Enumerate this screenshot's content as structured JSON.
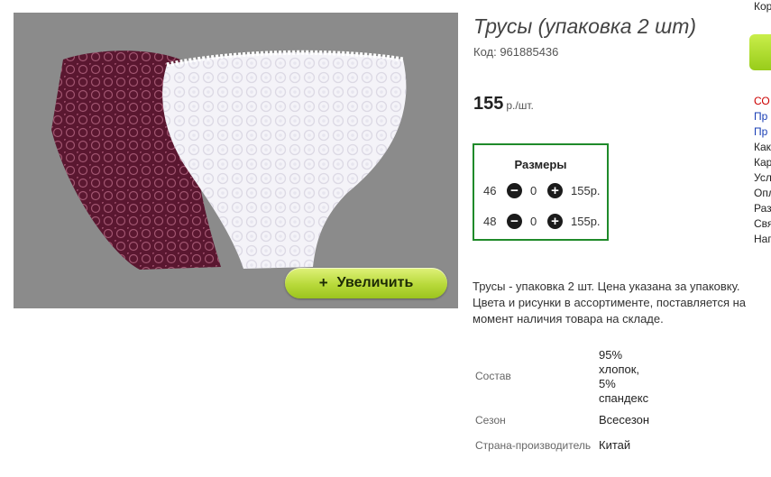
{
  "product": {
    "title": "Трусы (упаковка 2 шт)",
    "code": "Код: 961885436",
    "price": "155",
    "price_unit": "р./шт."
  },
  "image": {
    "zoom_plus": "+",
    "zoom_label": "Увеличить"
  },
  "sizes": {
    "header": "Размеры",
    "rows": [
      {
        "size": "46",
        "minus": "−",
        "qty": "0",
        "plus": "+",
        "price": "155р."
      },
      {
        "size": "48",
        "minus": "−",
        "qty": "0",
        "plus": "+",
        "price": "155р."
      }
    ]
  },
  "description": "Трусы - упаковка 2 шт. Цена указана за упаковку. Цвета и рисунки в ассортименте, поставляется на момент наличия товара на складе.",
  "specs": [
    {
      "label": "Состав",
      "value": "95%\nхлопок,\n5%\nспандекс"
    },
    {
      "label": "Сезон",
      "value": "Всесезон"
    },
    {
      "label": "Страна-производитель",
      "value": "Китай"
    }
  ],
  "sidebar": {
    "top": "Кор",
    "items": [
      "СО",
      "Пр",
      "Пр",
      "Как",
      "Кар",
      "Усл",
      "Опл",
      "Раз",
      "Свя",
      "Нап"
    ],
    "item_colors": [
      "#cc0000",
      "#1a3fb5",
      "#1a3fb5",
      "#222222",
      "#222222",
      "#222222",
      "#222222",
      "#222222",
      "#222222",
      "#222222"
    ]
  },
  "colors": {
    "accent_green": "#1f8a2a",
    "button_green": "#b8d93a",
    "image_bg": "#8b8b8b"
  }
}
